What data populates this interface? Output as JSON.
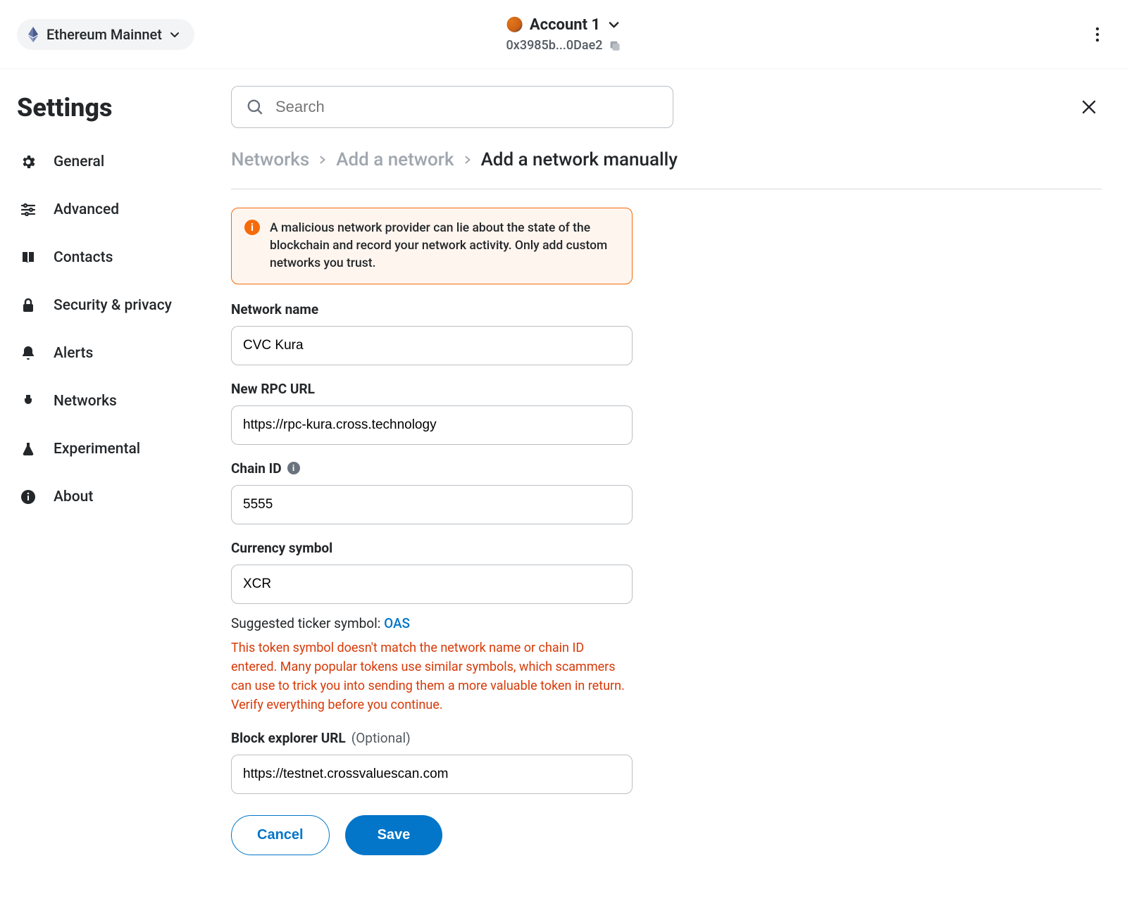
{
  "topbar": {
    "network_name": "Ethereum Mainnet",
    "account_name": "Account 1",
    "account_address": "0x3985b...0Dae2"
  },
  "page_title": "Settings",
  "search": {
    "placeholder": "Search"
  },
  "sidebar": {
    "items": [
      {
        "label": "General"
      },
      {
        "label": "Advanced"
      },
      {
        "label": "Contacts"
      },
      {
        "label": "Security & privacy"
      },
      {
        "label": "Alerts"
      },
      {
        "label": "Networks"
      },
      {
        "label": "Experimental"
      },
      {
        "label": "About"
      }
    ]
  },
  "breadcrumb": {
    "items": [
      "Networks",
      "Add a network",
      "Add a network manually"
    ]
  },
  "warning": "A malicious network provider can lie about the state of the blockchain and record your network activity. Only add custom networks you trust.",
  "form": {
    "network_name": {
      "label": "Network name",
      "value": "CVC Kura"
    },
    "rpc_url": {
      "label": "New RPC URL",
      "value": "https://rpc-kura.cross.technology"
    },
    "chain_id": {
      "label": "Chain ID",
      "value": "5555"
    },
    "currency_symbol": {
      "label": "Currency symbol",
      "value": "XCR",
      "suggested_label": "Suggested ticker symbol:",
      "suggested_value": "OAS",
      "error": "This token symbol doesn't match the network name or chain ID entered. Many popular tokens use similar symbols, which scammers can use to trick you into sending them a more valuable token in return. Verify everything before you continue."
    },
    "block_explorer": {
      "label": "Block explorer URL",
      "optional": "(Optional)",
      "value": "https://testnet.crossvaluescan.com"
    }
  },
  "buttons": {
    "cancel": "Cancel",
    "save": "Save"
  }
}
